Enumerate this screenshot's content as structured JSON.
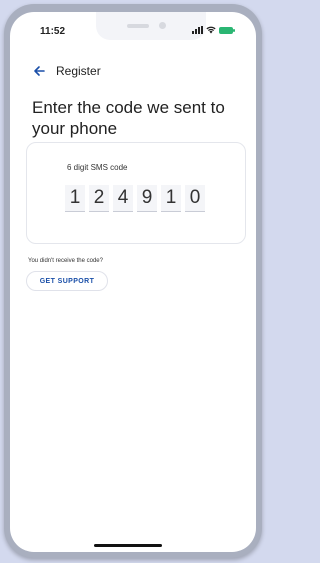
{
  "status_bar": {
    "time": "11:52",
    "icons": [
      "signal-icon",
      "wifi-icon",
      "battery-charging-icon"
    ],
    "battery_color": "#2bb673"
  },
  "nav": {
    "back_icon": "back-arrow-icon",
    "title": "Register"
  },
  "page": {
    "title": "Enter the code we sent to your phone"
  },
  "code": {
    "label": "6 digit SMS code",
    "digits": [
      "1",
      "2",
      "4",
      "9",
      "1",
      "0"
    ]
  },
  "support": {
    "prompt": "You didn't receive the code?",
    "button_label": "GET SUPPORT"
  },
  "colors": {
    "accent": "#1a4fa8",
    "background": "#d3d9ee"
  }
}
